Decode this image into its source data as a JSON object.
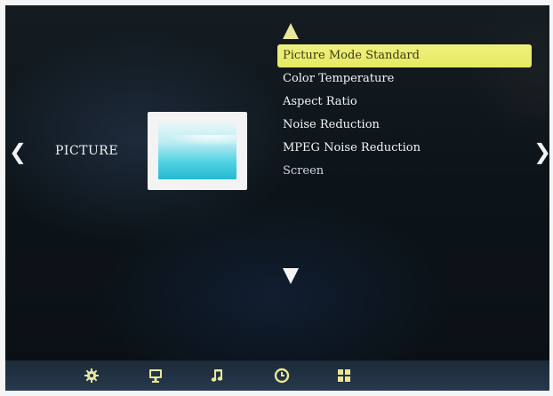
{
  "section": {
    "label": "PICTURE"
  },
  "navigation": {
    "left_arrow": "❮",
    "right_arrow": "❯"
  },
  "menu": {
    "items": [
      {
        "label": "Picture Mode Standard",
        "selected": true
      },
      {
        "label": "Color Temperature",
        "selected": false
      },
      {
        "label": "Aspect Ratio",
        "selected": false
      },
      {
        "label": "Noise Reduction",
        "selected": false
      },
      {
        "label": "MPEG Noise Reduction",
        "selected": false
      },
      {
        "label": "Screen",
        "selected": false
      }
    ]
  },
  "bottom_bar": {
    "icons": [
      "gear-icon",
      "monitor-icon",
      "music-note-icon",
      "clock-icon",
      "grid-icon"
    ]
  },
  "colors": {
    "selection": "#e9eb6c",
    "accent_icon": "#e9e797",
    "background": "#0f161c"
  }
}
